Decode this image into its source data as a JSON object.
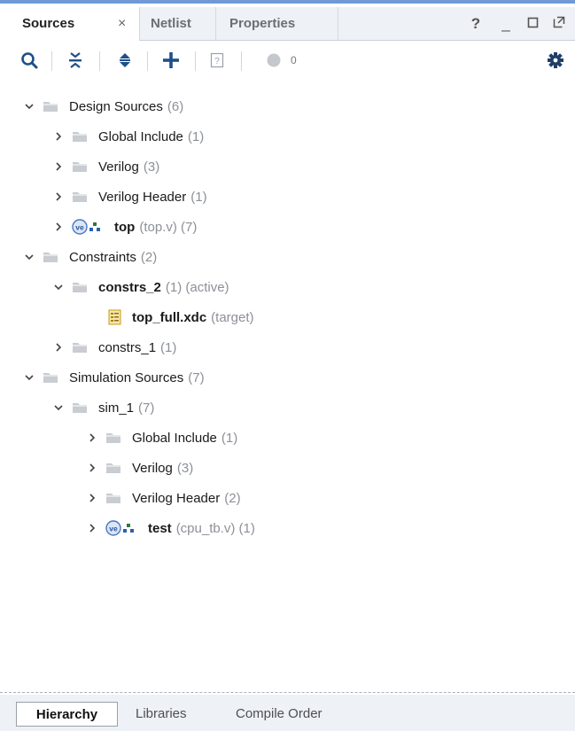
{
  "tabs": {
    "sources": "Sources",
    "close": "×",
    "netlist": "Netlist",
    "properties": "Properties"
  },
  "window_controls": {
    "help": "?",
    "minimize": "_"
  },
  "toolbar": {
    "search_icon": "search-icon",
    "collapse_icon": "collapse-all-icon",
    "expand_icon": "expand-all-icon",
    "add_icon": "add-sources-icon",
    "unknown_icon": "unknown-file-icon",
    "status_icon": "status-dot-icon",
    "status_count": "0",
    "settings_icon": "gear-icon"
  },
  "tree": {
    "design_sources": {
      "label": "Design Sources",
      "count": "(6)"
    },
    "ds_global_include": {
      "label": "Global Include",
      "count": "(1)"
    },
    "ds_verilog": {
      "label": "Verilog",
      "count": "(3)"
    },
    "ds_verilog_header": {
      "label": "Verilog Header",
      "count": "(1)"
    },
    "ds_top": {
      "label": "top",
      "count": "(top.v) (7)"
    },
    "constraints": {
      "label": "Constraints",
      "count": "(2)"
    },
    "constrs_2": {
      "label": "constrs_2",
      "count": "(1) (active)"
    },
    "top_full_xdc": {
      "label": "top_full.xdc",
      "count": "(target)"
    },
    "constrs_1": {
      "label": "constrs_1",
      "count": "(1)"
    },
    "simulation_sources": {
      "label": "Simulation Sources",
      "count": "(7)"
    },
    "sim_1": {
      "label": "sim_1",
      "count": "(7)"
    },
    "sim_global_include": {
      "label": "Global Include",
      "count": "(1)"
    },
    "sim_verilog": {
      "label": "Verilog",
      "count": "(3)"
    },
    "sim_verilog_header": {
      "label": "Verilog Header",
      "count": "(2)"
    },
    "sim_test": {
      "label": "test",
      "count": "(cpu_tb.v) (1)"
    }
  },
  "bottom_tabs": {
    "hierarchy": "Hierarchy",
    "libraries": "Libraries",
    "compile_order": "Compile Order"
  },
  "colors": {
    "accent_border": "#6f9ad4",
    "folder": "#c9ccd1",
    "count_text": "#8c9097"
  }
}
